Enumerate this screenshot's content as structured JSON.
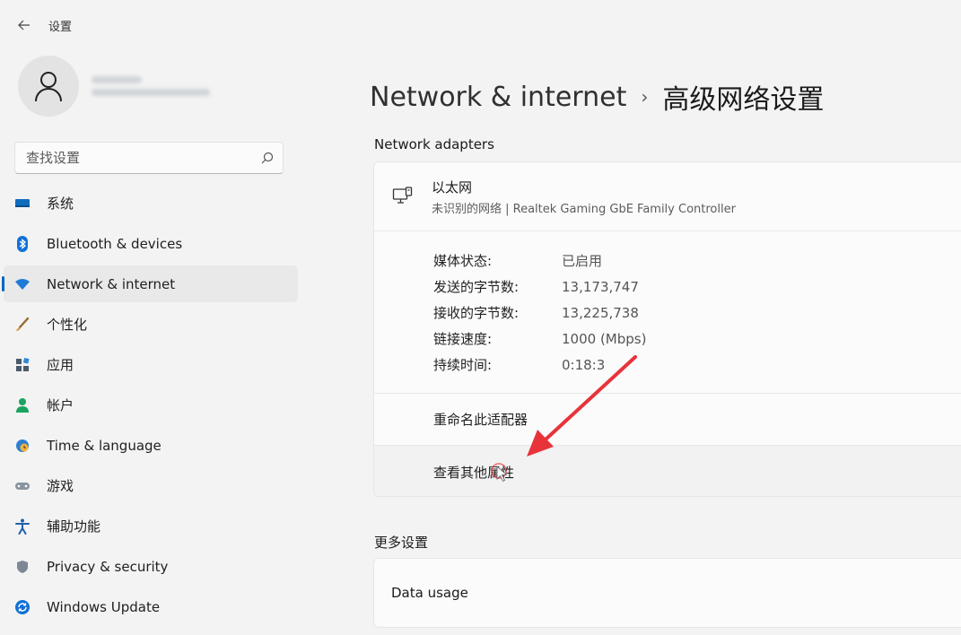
{
  "window": {
    "title": "设置"
  },
  "search": {
    "placeholder": "查找设置"
  },
  "sidebar": {
    "items": [
      {
        "label": "系统",
        "icon": "monitor-icon"
      },
      {
        "label": "Bluetooth & devices",
        "icon": "bluetooth-icon"
      },
      {
        "label": "Network & internet",
        "icon": "wifi-icon",
        "active": true
      },
      {
        "label": "个性化",
        "icon": "brush-icon"
      },
      {
        "label": "应用",
        "icon": "apps-icon"
      },
      {
        "label": "帐户",
        "icon": "person-icon"
      },
      {
        "label": "Time & language",
        "icon": "globe-clock-icon"
      },
      {
        "label": "游戏",
        "icon": "gamepad-icon"
      },
      {
        "label": "辅助功能",
        "icon": "accessibility-icon"
      },
      {
        "label": "Privacy & security",
        "icon": "shield-icon"
      },
      {
        "label": "Windows Update",
        "icon": "update-icon"
      }
    ]
  },
  "breadcrumb": {
    "parent": "Network & internet",
    "separator": "›",
    "current": "高级网络设置"
  },
  "network_adapters": {
    "title": "Network adapters",
    "adapter": {
      "name": "以太网",
      "description": "未识别的网络 | Realtek Gaming GbE Family Controller",
      "properties": [
        {
          "label": "媒体状态:",
          "value": "已启用"
        },
        {
          "label": "发送的字节数:",
          "value": "13,173,747"
        },
        {
          "label": "接收的字节数:",
          "value": "13,225,738"
        },
        {
          "label": "链接速度:",
          "value": "1000 (Mbps)"
        },
        {
          "label": "持续时间:",
          "value": "0:18:3"
        }
      ],
      "actions": [
        {
          "label": "重命名此适配器"
        },
        {
          "label": "查看其他属性"
        }
      ]
    }
  },
  "more_settings": {
    "title": "更多设置",
    "data_usage_label": "Data usage"
  },
  "colors": {
    "accent": "#0067c0",
    "arrow": "#e8333b"
  }
}
